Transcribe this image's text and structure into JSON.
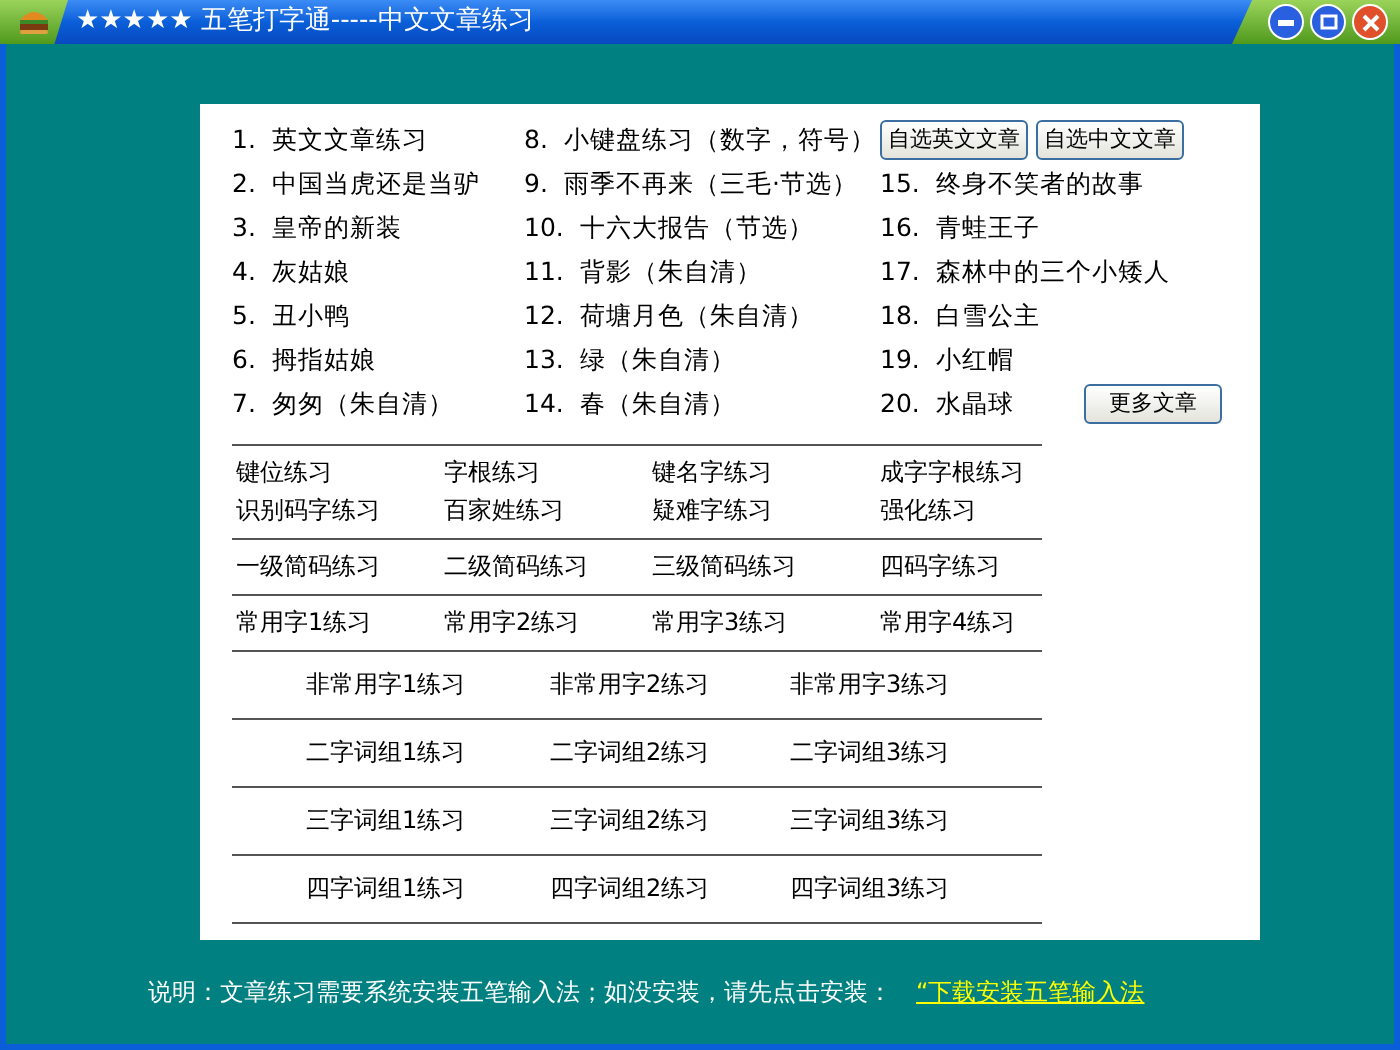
{
  "window": {
    "title": "★★★★★ 五笔打字通-----中文文章练习"
  },
  "article_columns": [
    [
      {
        "number": "1.",
        "title": "英文文章练习"
      },
      {
        "number": "2.",
        "title": "中国当虎还是当驴"
      },
      {
        "number": "3.",
        "title": "皇帝的新装"
      },
      {
        "number": "4.",
        "title": "灰姑娘"
      },
      {
        "number": "5.",
        "title": "丑小鸭"
      },
      {
        "number": "6.",
        "title": "拇指姑娘"
      },
      {
        "number": "7.",
        "title": "匆匆（朱自清）"
      }
    ],
    [
      {
        "number": "8.",
        "title": "小键盘练习（数字，符号）"
      },
      {
        "number": "9.",
        "title": "雨季不再来（三毛·节选）"
      },
      {
        "number": "10.",
        "title": "十六大报告（节选）"
      },
      {
        "number": "11.",
        "title": "背影（朱自清）"
      },
      {
        "number": "12.",
        "title": "荷塘月色（朱自清）"
      },
      {
        "number": "13.",
        "title": "绿（朱自清）"
      },
      {
        "number": "14.",
        "title": "春（朱自清）"
      }
    ],
    [
      {
        "number": "15.",
        "title": "终身不笑者的故事"
      },
      {
        "number": "16.",
        "title": "青蛙王子"
      },
      {
        "number": "17.",
        "title": "森林中的三个小矮人"
      },
      {
        "number": "18.",
        "title": "白雪公主"
      },
      {
        "number": "19.",
        "title": "小红帽"
      },
      {
        "number": "20.",
        "title": "水晶球"
      }
    ]
  ],
  "top_buttons": [
    "自选英文文章",
    "自选中文文章"
  ],
  "more_button": "更多文章",
  "practice_sections": [
    {
      "kind": "four",
      "items": [
        "键位练习",
        "字根练习",
        "键名字练习",
        "成字字根练习",
        "识别码字练习",
        "百家姓练习",
        "疑难字练习",
        "强化练习"
      ]
    },
    {
      "kind": "four",
      "items": [
        "一级简码练习",
        "二级简码练习",
        "三级简码练习",
        "四码字练习"
      ]
    },
    {
      "kind": "four",
      "items": [
        "常用字1练习",
        "常用字2练习",
        "常用字3练习",
        "常用字4练习"
      ]
    },
    {
      "kind": "three",
      "items": [
        "非常用字1练习",
        "非常用字2练习",
        "非常用字3练习"
      ]
    },
    {
      "kind": "three",
      "items": [
        "二字词组1练习",
        "二字词组2练习",
        "二字词组3练习"
      ]
    },
    {
      "kind": "three",
      "items": [
        "三字词组1练习",
        "三字词组2练习",
        "三字词组3练习"
      ]
    },
    {
      "kind": "three",
      "items": [
        "四字词组1练习",
        "四字词组2练习",
        "四字词组3练习"
      ]
    }
  ],
  "footer": {
    "note": "说明：文章练习需要系统安装五笔输入法；如没安装，请先点击安装：",
    "link": "“下载安装五笔输入法"
  }
}
